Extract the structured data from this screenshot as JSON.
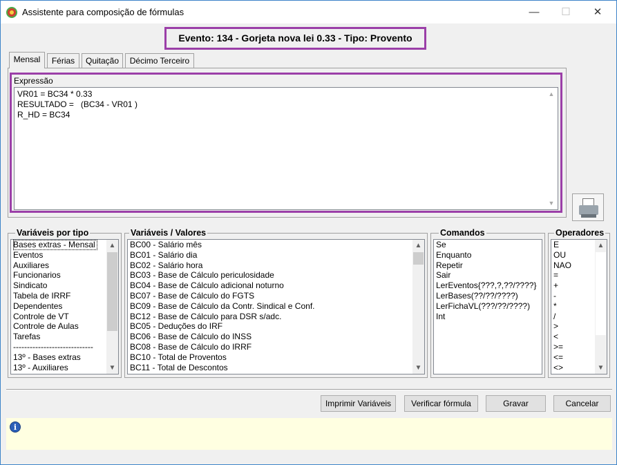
{
  "window": {
    "title": "Assistente para composição de fórmulas",
    "controls": {
      "minimize": "—",
      "maximize": "☐",
      "close": "✕"
    }
  },
  "evento_banner": "Evento: 134 - Gorjeta nova lei 0.33 - Tipo: Provento",
  "tabs": [
    {
      "label": "Mensal",
      "active": true
    },
    {
      "label": "Férias",
      "active": false
    },
    {
      "label": "Quitação",
      "active": false
    },
    {
      "label": "Décimo Terceiro",
      "active": false
    }
  ],
  "expressao": {
    "label": "Expressão",
    "lines": [
      "VR01 = BC34 * 0.33",
      "RESULTADO =   (BC34 - VR01 )",
      "R_HD = BC34"
    ]
  },
  "variaveis_por_tipo": {
    "title": "Variáveis por tipo",
    "items": [
      "Bases extras - Mensal",
      "Eventos",
      "Auxiliares",
      "Funcionarios",
      "Sindicato",
      "Tabela de IRRF",
      "Dependentes",
      "Controle de VT",
      "Controle de Aulas",
      "Tarefas",
      "-----------------------------",
      "13º - Bases extras",
      "13º - Auxiliares"
    ]
  },
  "variaveis_valores": {
    "title": "Variáveis / Valores",
    "items": [
      "BC00 - Salário mês",
      "BC01 - Salário dia",
      "BC02 - Salário hora",
      "BC03 - Base de Cálculo periculosidade",
      "BC04 - Base de Cálculo adicional noturno",
      "BC07 - Base de Cálculo do FGTS",
      "BC09 - Base de Cálculo da Contr. Sindical e Conf.",
      "BC12 - Base de Cálculo para DSR s/adc.",
      "BC05 - Deduções do IRF",
      "BC06 - Base de Cálculo do INSS",
      "BC08 - Base de Cálculo do IRRF",
      "BC10 - Total de Proventos",
      "BC11 - Total de Descontos"
    ]
  },
  "comandos": {
    "title": "Comandos",
    "items": [
      "Se",
      "Enquanto",
      "Repetir",
      "Sair",
      "LerEventos{???,?,??/????}",
      "LerBases(??/??/????)",
      "LerFichaVL(???/??/????)",
      "Int"
    ]
  },
  "operadores": {
    "title": "Operadores",
    "items": [
      "E",
      "OU",
      "NAO",
      "=",
      "+",
      "-",
      "*",
      "/",
      ">",
      "<",
      ">=",
      "<=",
      "<>"
    ]
  },
  "buttons": {
    "imprimir": "Imprimir Variáveis",
    "verificar": "Verificar fórmula",
    "gravar": "Gravar",
    "cancelar": "Cancelar"
  },
  "icons": {
    "printer": "printer-icon",
    "info": "info-icon"
  },
  "colors": {
    "highlight_border": "#9b3fa8",
    "info_bar": "#ffffe1",
    "window_border": "#3c83c9"
  }
}
